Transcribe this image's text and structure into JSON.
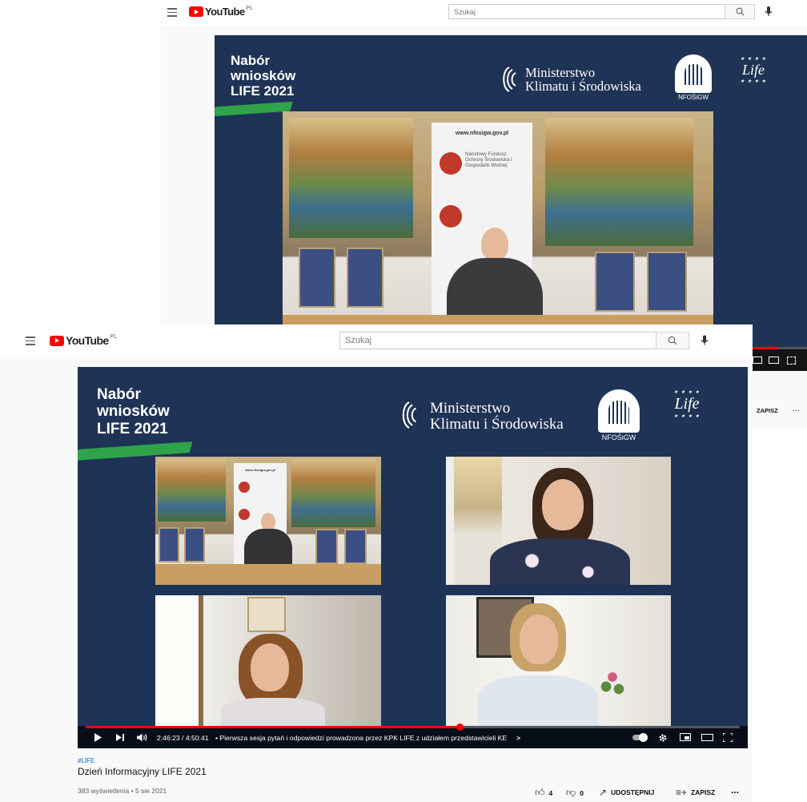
{
  "back_window": {
    "logo_text": "YouTube",
    "region_badge": "PL",
    "search_placeholder": "Szukaj",
    "banner": {
      "line1": "Nabór",
      "line2": "wniosków",
      "line3": "LIFE 2021"
    },
    "ministry": {
      "line1": "Ministerstwo",
      "line2": "Klimatu i Środowiska"
    },
    "nfos_label": "NFOŚiGW",
    "life_label": "Life",
    "standee_url": "www.nfosigw.gov.pl",
    "standee_text": "Narodowy Fundusz Ochrony Środowiska i Gospodarki Wodnej",
    "save_label": "ZAPISZ",
    "more_label": "..."
  },
  "front_window": {
    "logo_text": "YouTube",
    "region_badge": "PL",
    "search_placeholder": "Szukaj",
    "banner": {
      "line1": "Nabór",
      "line2": "wniosków",
      "line3": "LIFE 2021"
    },
    "ministry": {
      "line1": "Ministerstwo",
      "line2": "Klimatu i Środowiska"
    },
    "nfos_label": "NFOŚiGW",
    "life_label": "Life",
    "standee_url": "www.nfosigw.gov.pl",
    "player": {
      "time": "2:46:23 / 4:50:41",
      "chapter": "• Pierwsza sesja pytań i odpowiedzi prowadzona przez KPK LIFE z udziałem przedstawicieli KE",
      "chapter_arrow": ">",
      "progress": 0.572
    },
    "video": {
      "hashtag": "#LIFE",
      "title": "Dzień Informacyjny LIFE 2021",
      "stats": "383 wyświetlenia • 5 sie 2021"
    },
    "actions": {
      "likes": "4",
      "dislikes": "0",
      "share": "UDOSTĘPNIJ",
      "save": "ZAPISZ",
      "more": "..."
    }
  },
  "icons": [
    "menu-icon",
    "search-icon",
    "microphone-icon",
    "play-icon",
    "next-icon",
    "volume-icon",
    "autoplay-toggle-icon",
    "settings-icon",
    "miniplayer-icon",
    "theater-icon",
    "fullscreen-icon",
    "like-icon",
    "dislike-icon",
    "share-icon",
    "save-icon",
    "more-icon"
  ],
  "colors": {
    "brand_red": "#ff0000",
    "banner_navy": "#1e3355",
    "brush_green": "#2ea34a",
    "link_blue": "#065fd4"
  }
}
